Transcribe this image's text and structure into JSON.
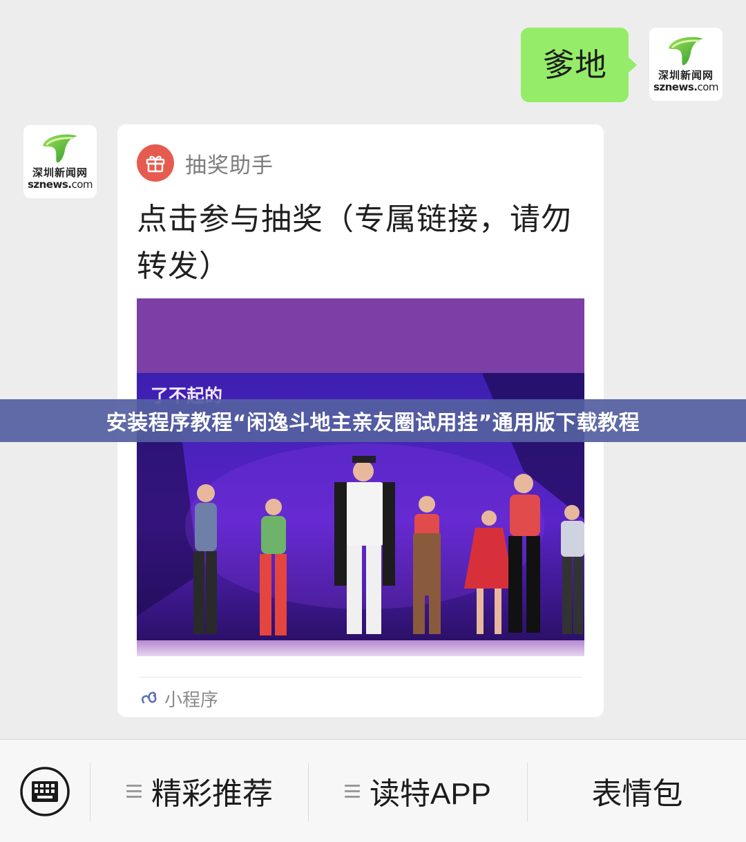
{
  "outgoing_message": {
    "text": "爹地"
  },
  "avatar": {
    "name_cn": "深圳新闻网",
    "name_en": "sznews",
    "name_en_suffix": "com"
  },
  "mini_program_card": {
    "source_name": "抽奖助手",
    "title": "点击参与抽奖（专属链接，请勿转发）",
    "footer_label": "小程序",
    "image_colors": {
      "top_band": "#7b3fa5",
      "stage": "#4b22b8",
      "floor": "#d8c7e6"
    },
    "image_overlay_text": "了不起的"
  },
  "overlay_banner": {
    "text": "安装程序教程“闲逸斗地主亲友圈试用挂”通用版下载教程"
  },
  "bottom_menu": {
    "items": [
      {
        "label": "精彩推荐",
        "has_submenu": true
      },
      {
        "label": "读特APP",
        "has_submenu": true
      },
      {
        "label": "表情包",
        "has_submenu": false
      }
    ]
  },
  "colors": {
    "chat_background": "#ededed",
    "outgoing_bubble": "#95ec69",
    "gift_badge": "#e65b4f",
    "banner": "#5460a0",
    "logo_green": "#3bb33b"
  },
  "icons": {
    "keyboard": "keyboard-icon",
    "gift": "gift-icon",
    "mini_program": "mini-program-icon",
    "menu": "menu-lines-icon"
  }
}
